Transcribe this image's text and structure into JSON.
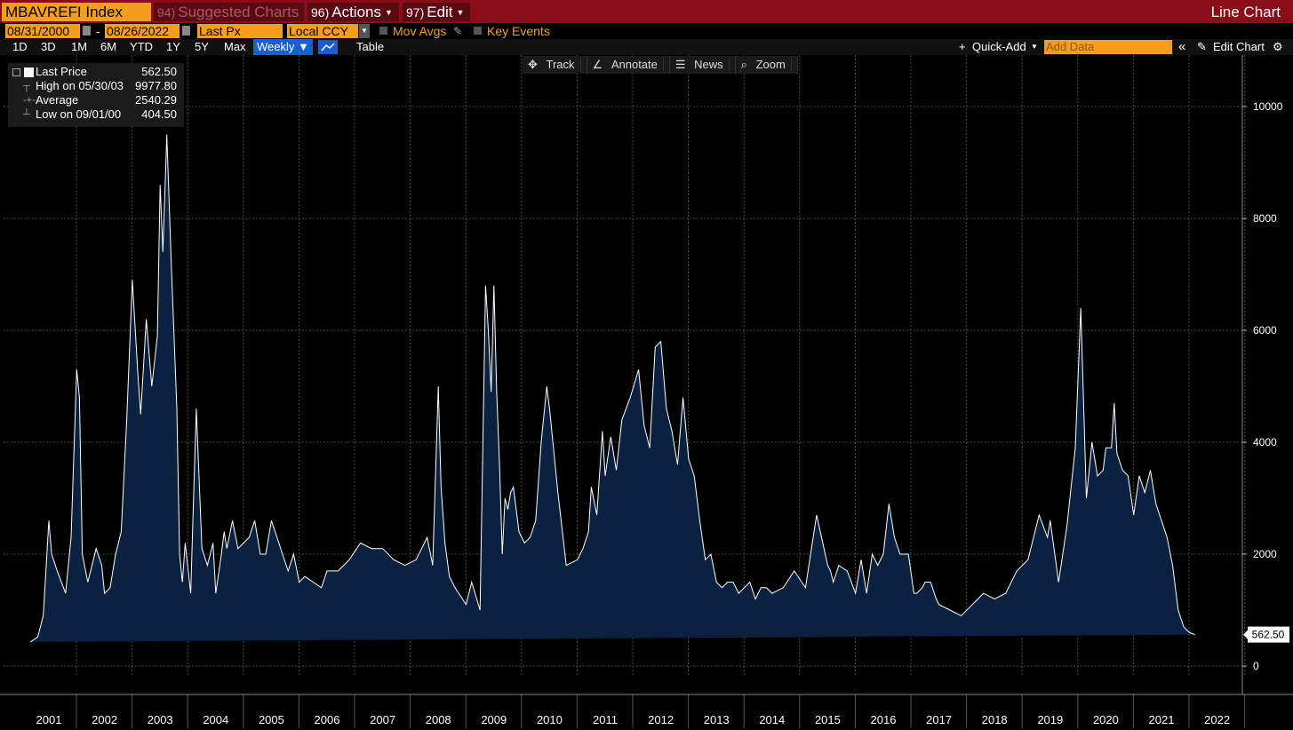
{
  "toolbar": {
    "ticker": "MBAVREFI Index",
    "suggested_num": "94)",
    "suggested_label": "Suggested Charts",
    "actions_num": "96)",
    "actions_label": "Actions",
    "edit_num": "97)",
    "edit_label": "Edit",
    "chart_type": "Line Chart"
  },
  "controls": {
    "start_date": "08/31/2000",
    "date_separator": "-",
    "end_date": "08/26/2022",
    "price_field": "Last Px",
    "currency": "Local CCY",
    "mov_avgs": "Mov Avgs",
    "key_events": "Key Events"
  },
  "ranges": {
    "items": [
      "1D",
      "3D",
      "1M",
      "6M",
      "YTD",
      "1Y",
      "5Y",
      "Max"
    ],
    "frequency": "Weekly ▼",
    "table": "Table"
  },
  "right_tools": {
    "quick_add": "Quick-Add",
    "add_data_placeholder": "Add Data",
    "edit_chart": "Edit Chart"
  },
  "chart_tools": [
    "Track",
    "Annotate",
    "News",
    "Zoom"
  ],
  "legend": {
    "last_label": "Last Price",
    "last_value": "562.50",
    "high_label": "High on 05/30/03",
    "high_value": "9977.80",
    "avg_label": "Average",
    "avg_value": "2540.29",
    "low_label": "Low on 09/01/00",
    "low_value": "404.50"
  },
  "colors": {
    "series_line": "#ffffff",
    "series_fill": "#0b2140",
    "accent_orange": "#f59e1b",
    "bar_red": "#8b0d19"
  },
  "chart_data": {
    "type": "area",
    "ylim": [
      -500,
      10600
    ],
    "y_ticks": [
      0,
      2000,
      4000,
      6000,
      8000,
      10000
    ],
    "x_tick_labels": [
      "2001",
      "2002",
      "2003",
      "2004",
      "2005",
      "2006",
      "2007",
      "2008",
      "2009",
      "2010",
      "2011",
      "2012",
      "2013",
      "2014",
      "2015",
      "2016",
      "2017",
      "2018",
      "2019",
      "2020",
      "2021",
      "2022"
    ],
    "last_value_label": "562.50",
    "grid": true,
    "x": [
      2000.67,
      2000.8,
      2000.9,
      2001.0,
      2001.05,
      2001.15,
      2001.3,
      2001.4,
      2001.5,
      2001.55,
      2001.6,
      2001.7,
      2001.85,
      2001.95,
      2002.0,
      2002.1,
      2002.2,
      2002.3,
      2002.4,
      2002.5,
      2002.6,
      2002.65,
      2002.75,
      2002.85,
      2002.95,
      2003.0,
      2003.05,
      2003.12,
      2003.2,
      2003.3,
      2003.35,
      2003.4,
      2003.45,
      2003.55,
      2003.6,
      2003.65,
      2003.75,
      2003.85,
      2003.95,
      2004.0,
      2004.1,
      2004.15,
      2004.2,
      2004.3,
      2004.4,
      2004.5,
      2004.6,
      2004.7,
      2004.8,
      2004.9,
      2005.0,
      2005.1,
      2005.2,
      2005.3,
      2005.4,
      2005.5,
      2005.6,
      2005.75,
      2005.9,
      2006.0,
      2006.2,
      2006.4,
      2006.6,
      2006.8,
      2007.0,
      2007.2,
      2007.4,
      2007.6,
      2007.8,
      2007.9,
      2008.0,
      2008.05,
      2008.12,
      2008.2,
      2008.3,
      2008.5,
      2008.6,
      2008.75,
      2008.85,
      2008.9,
      2008.95,
      2009.0,
      2009.05,
      2009.1,
      2009.15,
      2009.2,
      2009.25,
      2009.3,
      2009.35,
      2009.45,
      2009.55,
      2009.65,
      2009.75,
      2009.85,
      2009.95,
      2010.0,
      2010.15,
      2010.3,
      2010.5,
      2010.6,
      2010.7,
      2010.75,
      2010.85,
      2010.95,
      2011.0,
      2011.1,
      2011.2,
      2011.3,
      2011.45,
      2011.6,
      2011.7,
      2011.8,
      2011.9,
      2012.0,
      2012.1,
      2012.2,
      2012.3,
      2012.4,
      2012.5,
      2012.6,
      2012.7,
      2012.8,
      2012.9,
      2013.0,
      2013.1,
      2013.2,
      2013.3,
      2013.4,
      2013.5,
      2013.6,
      2013.7,
      2013.8,
      2013.9,
      2014.0,
      2014.2,
      2014.4,
      2014.6,
      2014.8,
      2015.0,
      2015.05,
      2015.1,
      2015.2,
      2015.35,
      2015.5,
      2015.6,
      2015.7,
      2015.8,
      2015.9,
      2016.0,
      2016.1,
      2016.2,
      2016.3,
      2016.45,
      2016.55,
      2016.6,
      2016.7,
      2016.75,
      2016.85,
      2016.95,
      2017.0,
      2017.2,
      2017.4,
      2017.6,
      2017.8,
      2018.0,
      2018.2,
      2018.4,
      2018.6,
      2018.8,
      2018.95,
      2019.0,
      2019.15,
      2019.3,
      2019.45,
      2019.55,
      2019.65,
      2019.75,
      2019.85,
      2019.95,
      2020.0,
      2020.05,
      2020.1,
      2020.15,
      2020.2,
      2020.3,
      2020.4,
      2020.5,
      2020.6,
      2020.7,
      2020.8,
      2020.9,
      2021.0,
      2021.1,
      2021.2,
      2021.3,
      2021.4,
      2021.5,
      2021.6,
      2021.7,
      2021.8,
      2021.9,
      2022.0,
      2022.1,
      2022.2,
      2022.3,
      2022.4,
      2022.5,
      2022.65
    ],
    "y": [
      430,
      520,
      900,
      2600,
      2000,
      1700,
      1300,
      2300,
      5300,
      4800,
      2000,
      1500,
      2100,
      1800,
      1300,
      1400,
      2000,
      2400,
      4400,
      6900,
      5200,
      4500,
      6200,
      5000,
      5900,
      8600,
      7400,
      9500,
      7200,
      4600,
      2000,
      1500,
      2200,
      1300,
      3000,
      4600,
      2100,
      1800,
      2200,
      1300,
      2000,
      2400,
      2100,
      2600,
      2100,
      2200,
      2300,
      2600,
      2000,
      2000,
      2600,
      2300,
      2000,
      1700,
      2000,
      1500,
      1600,
      1500,
      1400,
      1700,
      1700,
      1900,
      2200,
      2100,
      2100,
      1900,
      1800,
      1900,
      2300,
      1800,
      5000,
      3200,
      2200,
      1600,
      1400,
      1100,
      1500,
      1000,
      6800,
      6000,
      4900,
      6800,
      4900,
      3600,
      2000,
      3000,
      2800,
      3100,
      3200,
      2400,
      2200,
      2300,
      2600,
      4000,
      5000,
      4600,
      3100,
      1800,
      1900,
      2100,
      2400,
      3200,
      2700,
      4200,
      3400,
      4100,
      3500,
      4400,
      4800,
      5300,
      4300,
      3900,
      5700,
      5800,
      4600,
      4200,
      3600,
      4800,
      3700,
      3400,
      2600,
      1900,
      2000,
      1500,
      1400,
      1500,
      1500,
      1300,
      1400,
      1500,
      1200,
      1400,
      1400,
      1300,
      1400,
      1700,
      1400,
      2700,
      1800,
      1700,
      1500,
      1800,
      1700,
      1300,
      1900,
      1300,
      2000,
      1800,
      2000,
      2900,
      2300,
      2000,
      2000,
      1300,
      1300,
      1400,
      1500,
      1500,
      1200,
      1100,
      1000,
      900,
      1100,
      1300,
      1200,
      1300,
      1700,
      1900,
      2700,
      2300,
      2600,
      1500,
      2500,
      3900,
      6400,
      3000,
      4000,
      3400,
      3500,
      3900,
      3900,
      3900,
      4700,
      3800,
      3500,
      3400,
      2700,
      3400,
      3100,
      3500,
      2900,
      2600,
      2300,
      1800,
      1000,
      700,
      600,
      562.5
    ]
  }
}
